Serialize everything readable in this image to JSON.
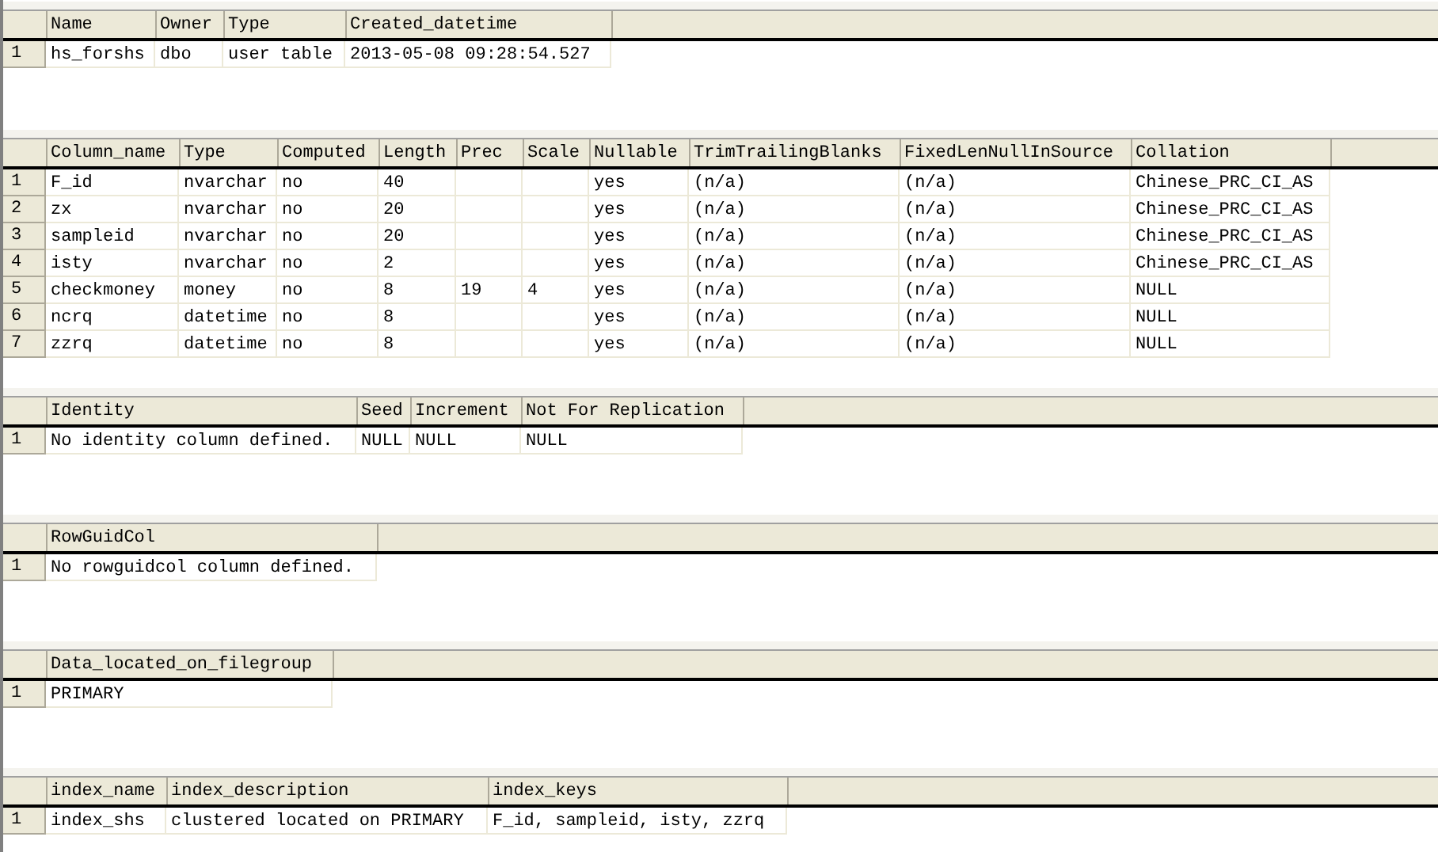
{
  "grids": [
    {
      "columns": [
        "Name",
        "Owner",
        "Type",
        "Created_datetime"
      ],
      "rows": [
        {
          "number": "1",
          "cells": [
            "hs_forshs",
            "dbo",
            "user table",
            "2013-05-08 09:28:54.527"
          ]
        }
      ]
    },
    {
      "columns": [
        "Column_name",
        "Type",
        "Computed",
        "Length",
        "Prec",
        "Scale",
        "Nullable",
        "TrimTrailingBlanks",
        "FixedLenNullInSource",
        "Collation"
      ],
      "rows": [
        {
          "number": "1",
          "cells": [
            "F_id",
            "nvarchar",
            "no",
            "40",
            null,
            null,
            "yes",
            "(n/a)",
            "(n/a)",
            "Chinese_PRC_CI_AS"
          ]
        },
        {
          "number": "2",
          "cells": [
            "zx",
            "nvarchar",
            "no",
            "20",
            null,
            null,
            "yes",
            "(n/a)",
            "(n/a)",
            "Chinese_PRC_CI_AS"
          ]
        },
        {
          "number": "3",
          "cells": [
            "sampleid",
            "nvarchar",
            "no",
            "20",
            null,
            null,
            "yes",
            "(n/a)",
            "(n/a)",
            "Chinese_PRC_CI_AS"
          ]
        },
        {
          "number": "4",
          "cells": [
            "isty",
            "nvarchar",
            "no",
            "2",
            null,
            null,
            "yes",
            "(n/a)",
            "(n/a)",
            "Chinese_PRC_CI_AS"
          ]
        },
        {
          "number": "5",
          "cells": [
            "checkmoney",
            "money",
            "no",
            "8",
            "19",
            "4",
            "yes",
            "(n/a)",
            "(n/a)",
            "NULL"
          ]
        },
        {
          "number": "6",
          "cells": [
            "ncrq",
            "datetime",
            "no",
            "8",
            null,
            null,
            "yes",
            "(n/a)",
            "(n/a)",
            "NULL"
          ]
        },
        {
          "number": "7",
          "cells": [
            "zzrq",
            "datetime",
            "no",
            "8",
            null,
            null,
            "yes",
            "(n/a)",
            "(n/a)",
            "NULL"
          ]
        }
      ]
    },
    {
      "columns": [
        "Identity",
        "Seed",
        "Increment",
        "Not For Replication"
      ],
      "rows": [
        {
          "number": "1",
          "cells": [
            "No identity column defined.",
            "NULL",
            "NULL",
            "NULL"
          ]
        }
      ]
    },
    {
      "columns": [
        "RowGuidCol"
      ],
      "rows": [
        {
          "number": "1",
          "cells": [
            "No rowguidcol column defined."
          ]
        }
      ]
    },
    {
      "columns": [
        "Data_located_on_filegroup"
      ],
      "rows": [
        {
          "number": "1",
          "cells": [
            "PRIMARY"
          ]
        }
      ]
    },
    {
      "columns": [
        "index_name",
        "index_description",
        "index_keys"
      ],
      "rows": [
        {
          "number": "1",
          "cells": [
            "index_shs",
            "clustered located on PRIMARY",
            "F_id, sampleid, isty, zzrq"
          ]
        }
      ]
    }
  ]
}
